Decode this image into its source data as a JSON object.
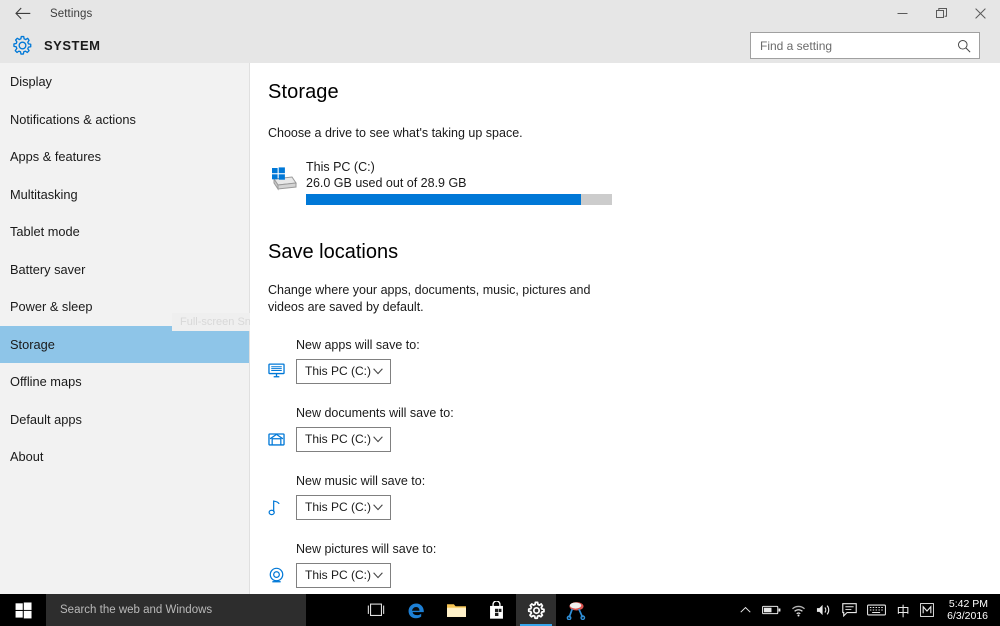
{
  "window": {
    "title": "Settings",
    "back_icon": "back-arrow-icon",
    "minimize_label": "Minimize",
    "restore_label": "Restore",
    "close_label": "Close"
  },
  "header": {
    "icon": "gear-icon",
    "title": "SYSTEM",
    "search": {
      "placeholder": "Find a setting",
      "value": "",
      "icon": "search-icon"
    }
  },
  "sidebar": {
    "items": [
      {
        "label": "Display",
        "selected": false
      },
      {
        "label": "Notifications & actions",
        "selected": false
      },
      {
        "label": "Apps & features",
        "selected": false
      },
      {
        "label": "Multitasking",
        "selected": false
      },
      {
        "label": "Tablet mode",
        "selected": false
      },
      {
        "label": "Battery saver",
        "selected": false
      },
      {
        "label": "Power & sleep",
        "selected": false
      },
      {
        "label": "Storage",
        "selected": true
      },
      {
        "label": "Offline maps",
        "selected": false
      },
      {
        "label": "Default apps",
        "selected": false
      },
      {
        "label": "About",
        "selected": false
      }
    ],
    "watermark": "Full-screen Snip"
  },
  "content": {
    "storage": {
      "heading": "Storage",
      "subtitle": "Choose a drive to see what's taking up space.",
      "drive": {
        "icon": "hard-drive-icon",
        "name": "This PC (C:)",
        "usage": "26.0 GB used out of 28.9 GB",
        "used_gb": 26.0,
        "total_gb": 28.9,
        "percent_used": 90,
        "bar_color": "#0078d7",
        "track_color": "#cccccc"
      }
    },
    "save_locations": {
      "heading": "Save locations",
      "description": "Change where your apps, documents, music, pictures and videos are saved by default.",
      "groups": [
        {
          "label": "New apps will save to:",
          "icon": "monitor-icon",
          "value": "This PC (C:)"
        },
        {
          "label": "New documents will save to:",
          "icon": "documents-folder-icon",
          "value": "This PC (C:)"
        },
        {
          "label": "New music will save to:",
          "icon": "music-note-icon",
          "value": "This PC (C:)"
        },
        {
          "label": "New pictures will save to:",
          "icon": "camera-icon",
          "value": "This PC (C:)"
        }
      ]
    }
  },
  "taskbar": {
    "start": {
      "icon": "windows-start-icon",
      "label": "Start"
    },
    "search": {
      "placeholder": "Search the web and Windows"
    },
    "apps": [
      {
        "name": "task-view",
        "label": "Task View",
        "active": false
      },
      {
        "name": "edge",
        "label": "Microsoft Edge",
        "active": false
      },
      {
        "name": "file-explorer",
        "label": "File Explorer",
        "active": false
      },
      {
        "name": "store",
        "label": "Store",
        "active": false
      },
      {
        "name": "settings",
        "label": "Settings",
        "active": true
      },
      {
        "name": "snipping-tool",
        "label": "Snipping Tool",
        "active": false
      }
    ],
    "tray": [
      {
        "name": "show-hidden-icons",
        "label": "Show hidden icons"
      },
      {
        "name": "battery",
        "label": "Battery"
      },
      {
        "name": "network",
        "label": "Network"
      },
      {
        "name": "volume",
        "label": "Volume"
      },
      {
        "name": "action-center",
        "label": "Action Center"
      },
      {
        "name": "touch-keyboard",
        "label": "Touch keyboard"
      },
      {
        "name": "ime-chinese",
        "label": "中"
      },
      {
        "name": "ime-mode",
        "label": "M"
      }
    ],
    "clock": {
      "time": "5:42 PM",
      "date": "6/3/2016"
    }
  },
  "colors": {
    "accent": "#0078d7",
    "selection": "#8ec5e8",
    "chrome": "#e6e6e6",
    "sidebar": "#f2f2f2",
    "taskbar": "#000000"
  }
}
